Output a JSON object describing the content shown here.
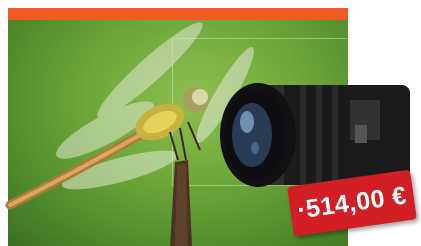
{
  "banner": {
    "accent_color": "#f15a22",
    "background_color": "#ffffff"
  },
  "photo": {
    "subject": "dragonfly-perched-on-twig",
    "background_color": "#6ea83a"
  },
  "product": {
    "icon": "camera-lens-icon"
  },
  "price_tag": {
    "text": "·514,00 €",
    "color": "#d21f26",
    "text_color": "#ffffff"
  }
}
